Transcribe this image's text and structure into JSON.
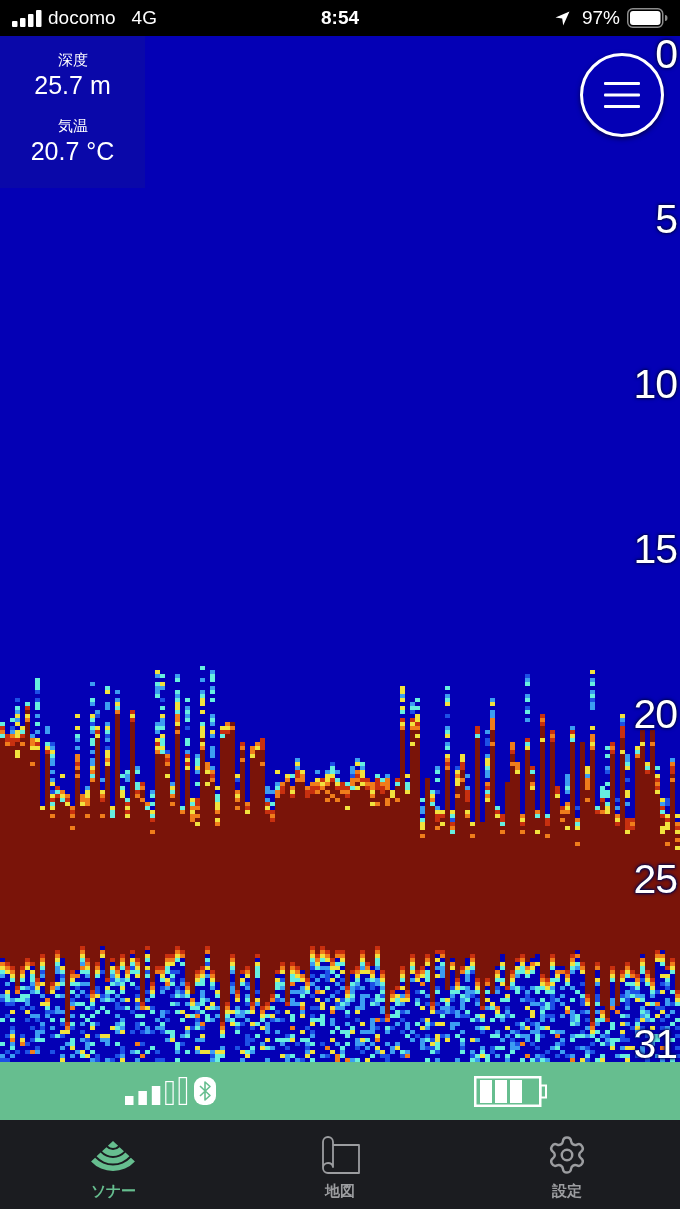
{
  "status_bar": {
    "carrier": "docomo",
    "network": "4G",
    "time": "8:54",
    "battery": "97%"
  },
  "sonar": {
    "readouts": [
      {
        "label": "深度",
        "value": "25.7 m"
      },
      {
        "label": "気温",
        "value": "20.7 °C"
      }
    ],
    "depth_scale": [
      "0",
      "5",
      "10",
      "15",
      "20",
      "25",
      "31"
    ]
  },
  "tabs": [
    {
      "label": "ソナー",
      "selected": true
    },
    {
      "label": "地図",
      "selected": false
    },
    {
      "label": "設定",
      "selected": false
    }
  ]
}
